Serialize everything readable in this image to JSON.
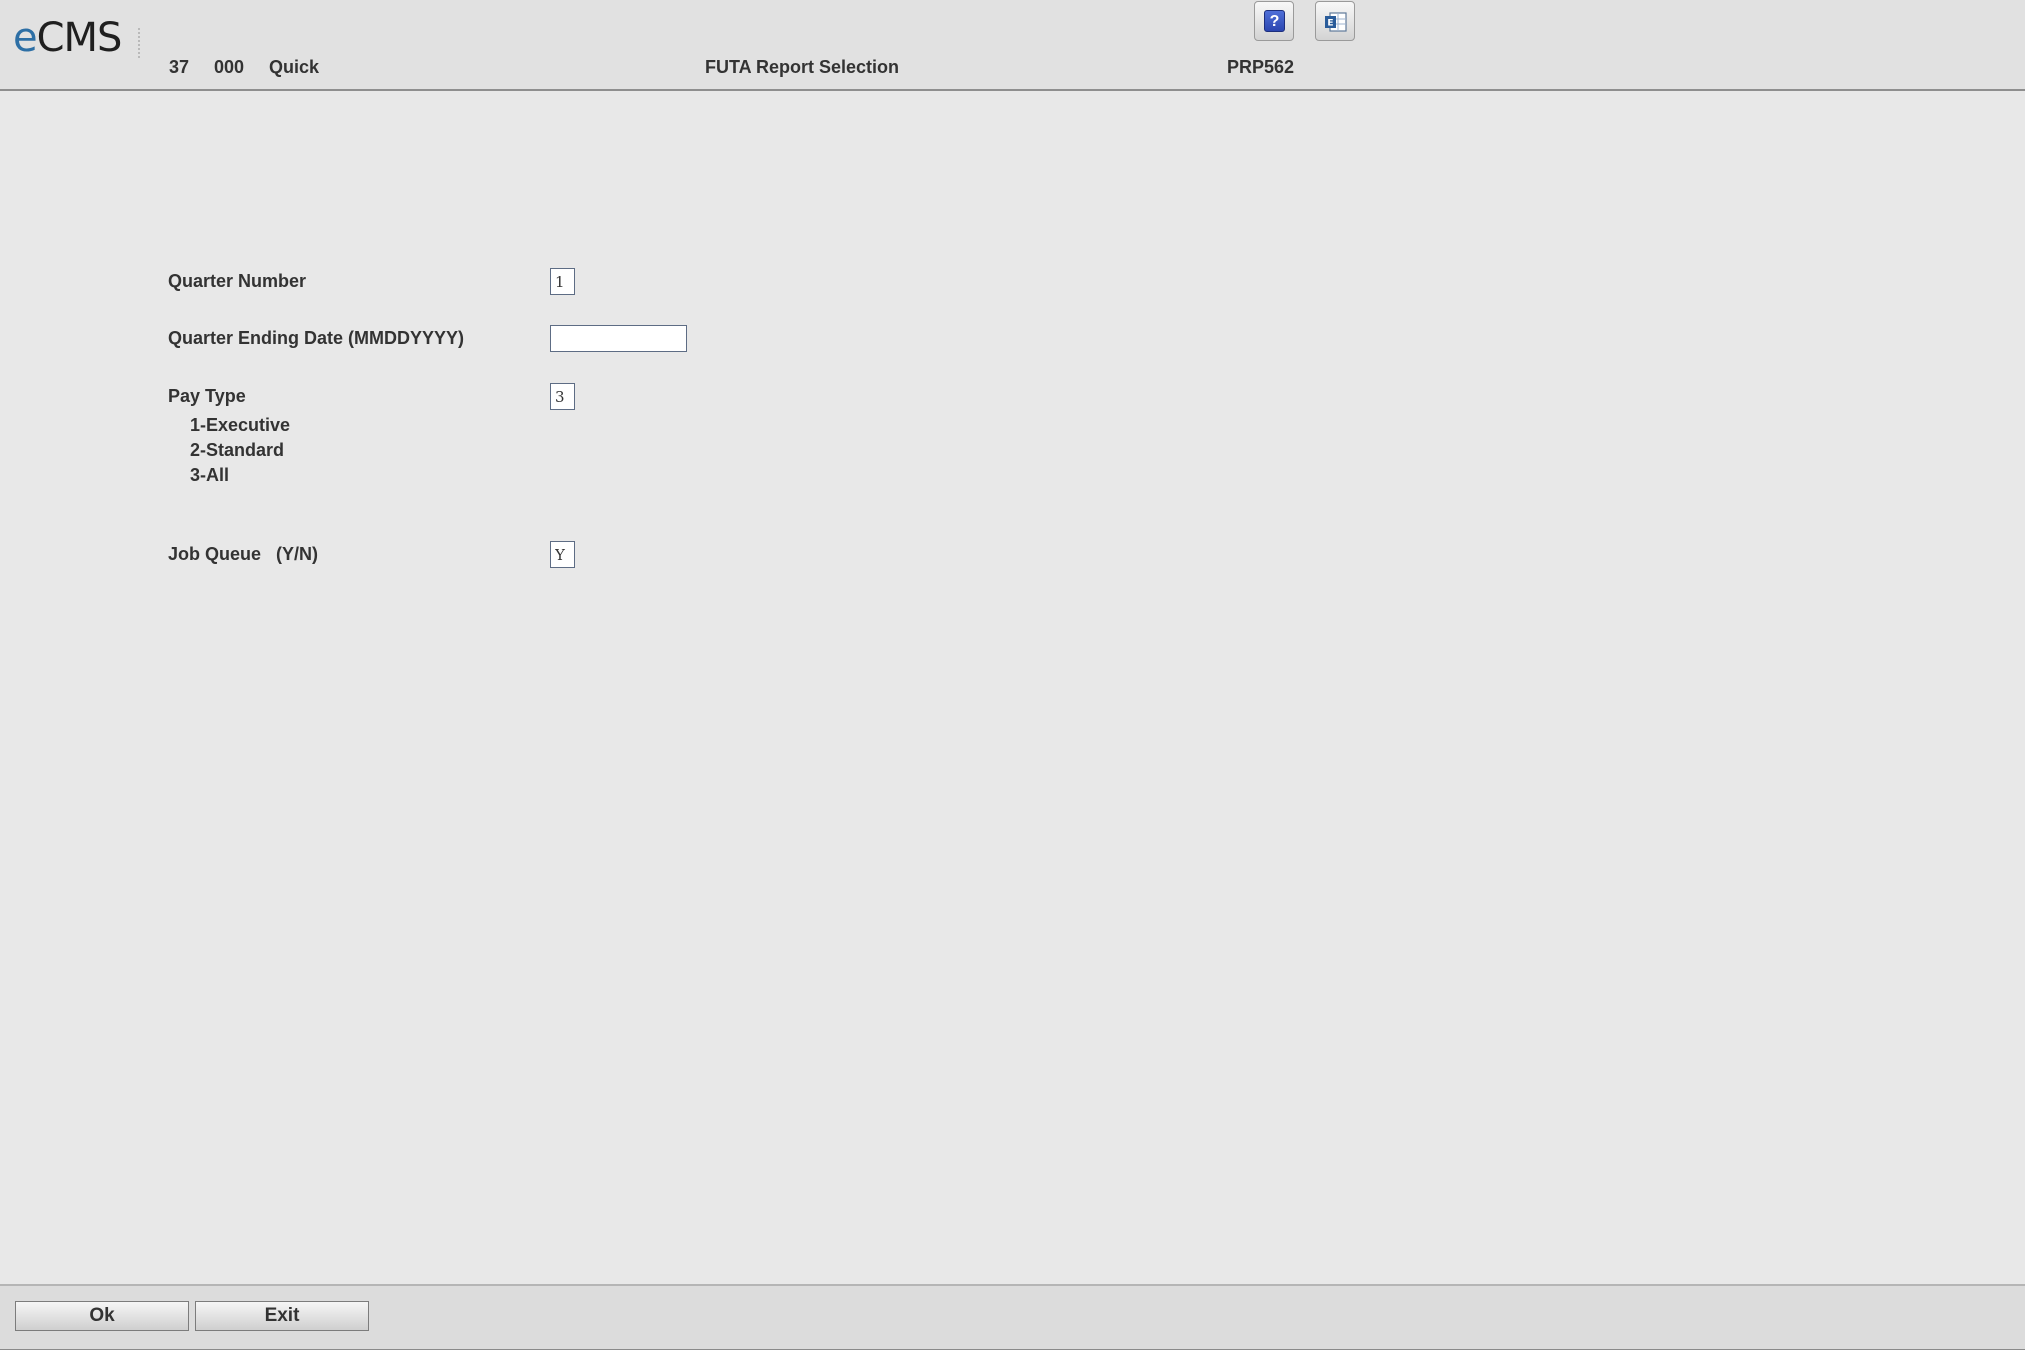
{
  "header": {
    "logo": {
      "prefix": "e",
      "rest": "CMS"
    },
    "company": "37",
    "division": "000",
    "mode": "Quick",
    "title": "FUTA Report Selection",
    "program": "PRP562",
    "help_icon_glyph": "?",
    "toolbar_icons": [
      "help-icon",
      "excel-export-icon"
    ]
  },
  "form": {
    "quarter_number": {
      "label": "Quarter Number",
      "value": "1"
    },
    "quarter_ending_date": {
      "label": "Quarter Ending Date (MMDDYYYY)",
      "value": ""
    },
    "pay_type": {
      "label": "Pay Type",
      "value": "3",
      "options": [
        "1-Executive",
        "2-Standard",
        "3-All"
      ]
    },
    "job_queue": {
      "label": "Job Queue   (Y/N)",
      "value": "Y"
    }
  },
  "footer": {
    "ok_label": "Ok",
    "exit_label": "Exit"
  },
  "colors": {
    "background": "#e8e8e8",
    "header_bg": "#e1e1e1",
    "logo_accent": "#2d6fa5",
    "field_border": "#5d6c84"
  }
}
